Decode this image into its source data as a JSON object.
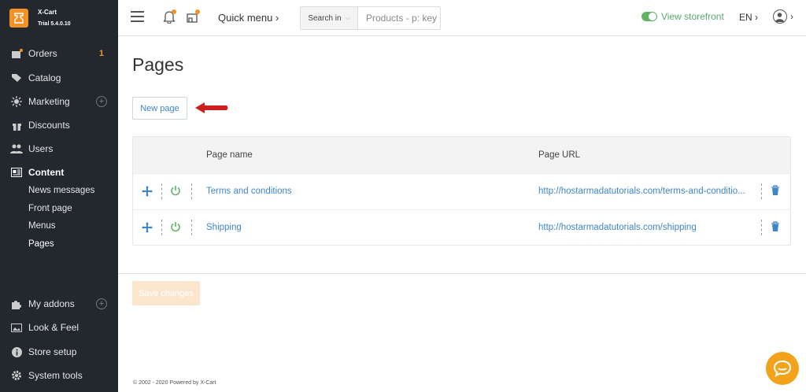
{
  "brand": {
    "name": "X-Cart",
    "version": "Trial 5.4.0.10"
  },
  "sidebar": {
    "items": [
      {
        "label": "Orders",
        "badge": "1",
        "icon": "orders-icon"
      },
      {
        "label": "Catalog",
        "icon": "tag-icon"
      },
      {
        "label": "Marketing",
        "icon": "megaphone-icon"
      },
      {
        "label": "Discounts",
        "icon": "gift-icon"
      },
      {
        "label": "Users",
        "icon": "users-icon"
      },
      {
        "label": "Content",
        "icon": "content-icon"
      },
      {
        "label": "My addons",
        "icon": "puzzle-icon"
      },
      {
        "label": "Look & Feel",
        "icon": "image-icon"
      },
      {
        "label": "Store setup",
        "icon": "info-icon"
      },
      {
        "label": "System tools",
        "icon": "gear-icon"
      }
    ],
    "content_sub": [
      "News messages",
      "Front page",
      "Menus",
      "Pages"
    ]
  },
  "topbar": {
    "quick_menu": "Quick menu",
    "search_in": "Search in",
    "search_placeholder": "Products - p: key",
    "storefront": "View storefront",
    "lang": "EN"
  },
  "main": {
    "title": "Pages",
    "new_button": "New page",
    "columns": [
      "Page name",
      "Page URL"
    ],
    "rows": [
      {
        "name": "Terms and conditions",
        "url": "http://hostarmadatutorials.com/terms-and-conditio..."
      },
      {
        "name": "Shipping",
        "url": "http://hostarmadatutorials.com/shipping"
      }
    ],
    "save_button": "Save changes",
    "footer": "© 2002 - 2020 Powered by X-Cart"
  },
  "colors": {
    "sidebar_bg": "#22282d",
    "accent": "#f29126",
    "link": "#3f86c7",
    "success": "#5fb565",
    "arrow": "#cc1f1f"
  }
}
